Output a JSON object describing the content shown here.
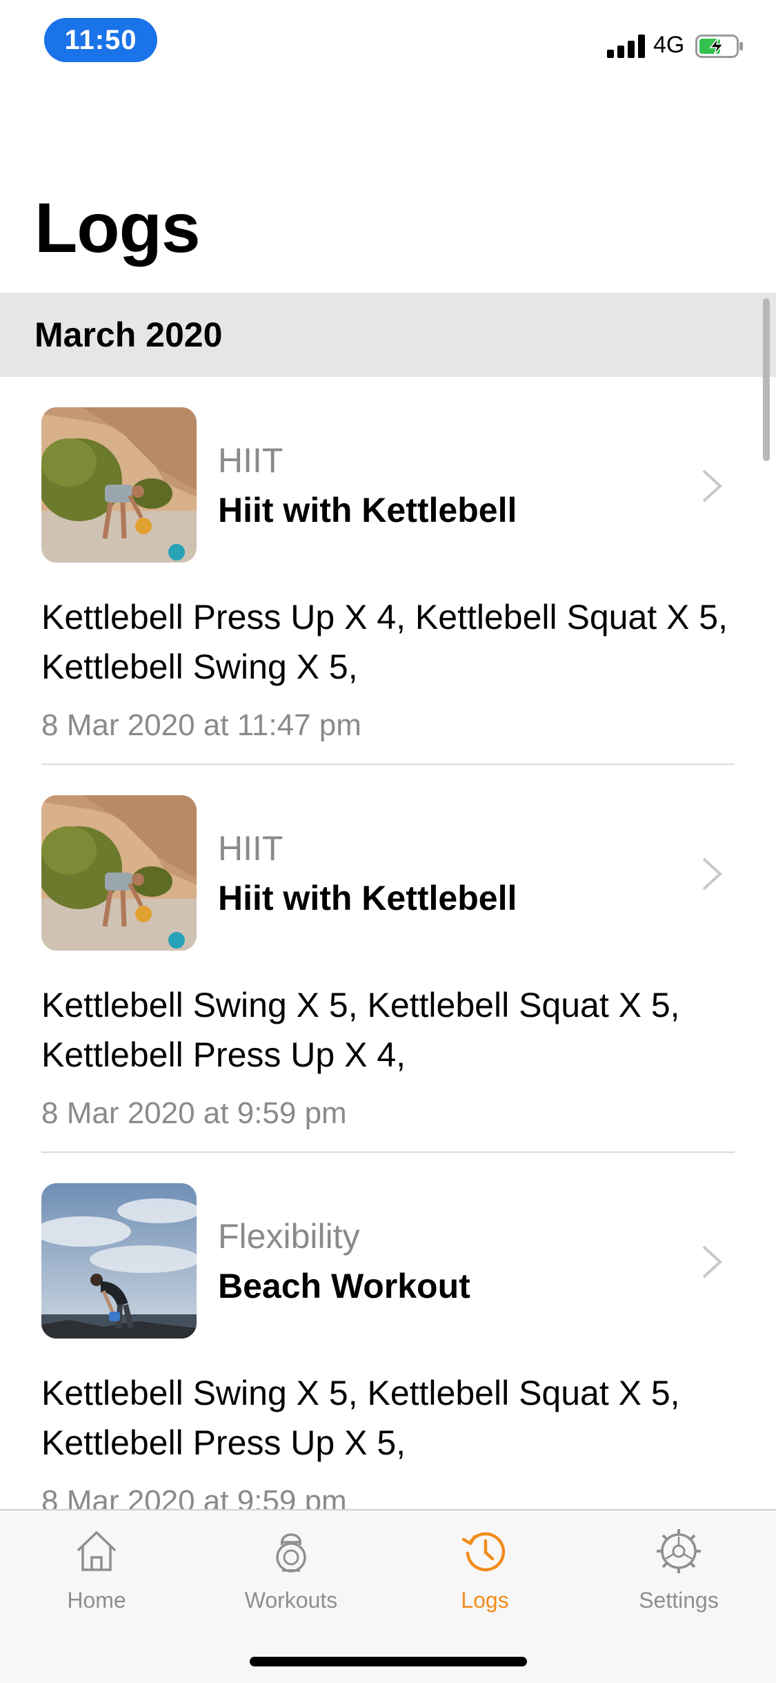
{
  "status_bar": {
    "time": "11:50",
    "network": "4G",
    "time_pill_color": "#1a73e8",
    "battery_fill_color": "#33c24d"
  },
  "header": {
    "title": "Logs"
  },
  "section": {
    "label": "March 2020"
  },
  "logs": [
    {
      "category": "HIIT",
      "name": "Hiit with Kettlebell",
      "exercises": "Kettlebell Press Up X 4, Kettlebell Squat X 5, Kettlebell Swing X 5,",
      "date": "8 Mar 2020 at 11:47 pm",
      "thumbnail": "cliff-kettlebell-photo"
    },
    {
      "category": "HIIT",
      "name": "Hiit with Kettlebell",
      "exercises": "Kettlebell Swing X 5, Kettlebell Squat X 5, Kettlebell Press Up X 4,",
      "date": "8 Mar 2020 at 9:59 pm",
      "thumbnail": "cliff-kettlebell-photo"
    },
    {
      "category": "Flexibility",
      "name": "Beach Workout",
      "exercises": "Kettlebell Swing X 5, Kettlebell Squat X 5, Kettlebell Press Up X 5,",
      "date": "8 Mar 2020 at 9:59 pm",
      "thumbnail": "beach-workout-photo"
    }
  ],
  "tab_bar": {
    "active_color": "#f28c1c",
    "inactive_color": "#8e8e93",
    "tabs": [
      {
        "label": "Home",
        "icon": "house-icon",
        "active": false
      },
      {
        "label": "Workouts",
        "icon": "kettlebell-icon",
        "active": false
      },
      {
        "label": "Logs",
        "icon": "history-clock-icon",
        "active": true
      },
      {
        "label": "Settings",
        "icon": "gear-icon",
        "active": false
      }
    ]
  }
}
